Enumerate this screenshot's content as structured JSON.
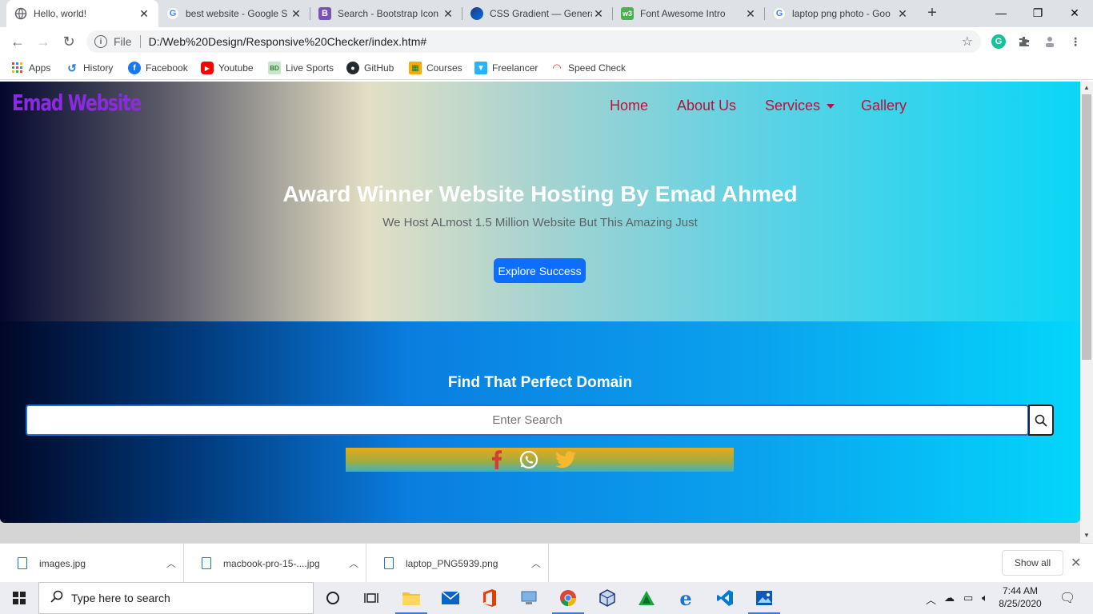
{
  "browser": {
    "tabs": [
      {
        "title": "Hello, world!",
        "favicon": "globe-icon"
      },
      {
        "title": "best website - Google S",
        "favicon": "google-icon"
      },
      {
        "title": "Search - Bootstrap Icon",
        "favicon": "bootstrap-icon"
      },
      {
        "title": "CSS Gradient — Genera",
        "favicon": "css-gradient-icon"
      },
      {
        "title": "Font Awesome Intro",
        "favicon": "w3schools-icon"
      },
      {
        "title": "laptop png photo - Goo",
        "favicon": "google-icon"
      }
    ],
    "address": {
      "scheme": "File",
      "url": "D:/Web%20Design/Responsive%20Checker/index.htm#"
    },
    "bookmarks": [
      {
        "label": "Apps",
        "icon": "apps-grid-icon"
      },
      {
        "label": "History",
        "icon": "history-icon"
      },
      {
        "label": "Facebook",
        "icon": "facebook-icon"
      },
      {
        "label": "Youtube",
        "icon": "youtube-icon"
      },
      {
        "label": "Live Sports",
        "icon": "live-sports-icon"
      },
      {
        "label": "GitHub",
        "icon": "github-icon"
      },
      {
        "label": "Courses",
        "icon": "courses-icon"
      },
      {
        "label": "Freelancer",
        "icon": "freelancer-icon"
      },
      {
        "label": "Speed Check",
        "icon": "speedometer-icon"
      }
    ]
  },
  "site": {
    "brand": "Emad Website",
    "nav": [
      "Home",
      "About Us",
      "Services",
      "Gallery"
    ],
    "hero": {
      "title": "Award Winner Website Hosting By Emad Ahmed",
      "subtitle": "We Host ALmost 1.5 Million Website But This Amazing Just",
      "button": "Explore Success"
    },
    "domain": {
      "title": "Find That Perfect Domain",
      "placeholder": "Enter Search"
    },
    "social": [
      "facebook-icon",
      "whatsapp-icon",
      "twitter-icon"
    ],
    "colors": {
      "brand": "#8a2be2",
      "nav": "#b8123c",
      "button": "#0d6efd"
    }
  },
  "downloads": {
    "items": [
      "images.jpg",
      "macbook-pro-15-....jpg",
      "laptop_PNG5939.png"
    ],
    "show_all": "Show all"
  },
  "taskbar": {
    "search_placeholder": "Type here to search",
    "time": "7:44 AM",
    "date": "8/25/2020"
  }
}
